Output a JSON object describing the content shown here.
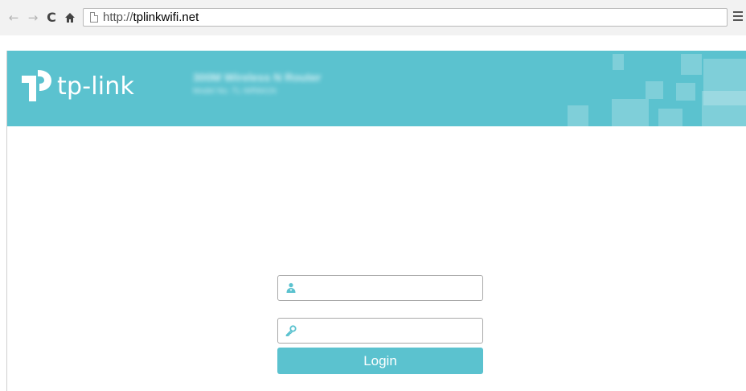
{
  "browser": {
    "url_scheme": "http://",
    "url_host": "tplinkwifi.net",
    "icons": [
      "back-arrow-icon",
      "forward-arrow-icon",
      "reload-icon",
      "home-icon",
      "page-icon",
      "menu-icon"
    ]
  },
  "header": {
    "brand": "tp-link",
    "model_name": "300M Wireless N Router",
    "model_number": "Model No. TL-WR841N",
    "color": "#5bc2cf"
  },
  "login": {
    "username_value": "",
    "password_value": "",
    "button_label": "Login",
    "icons": [
      "user-icon",
      "key-icon"
    ],
    "accent": "#5bc2cf"
  }
}
